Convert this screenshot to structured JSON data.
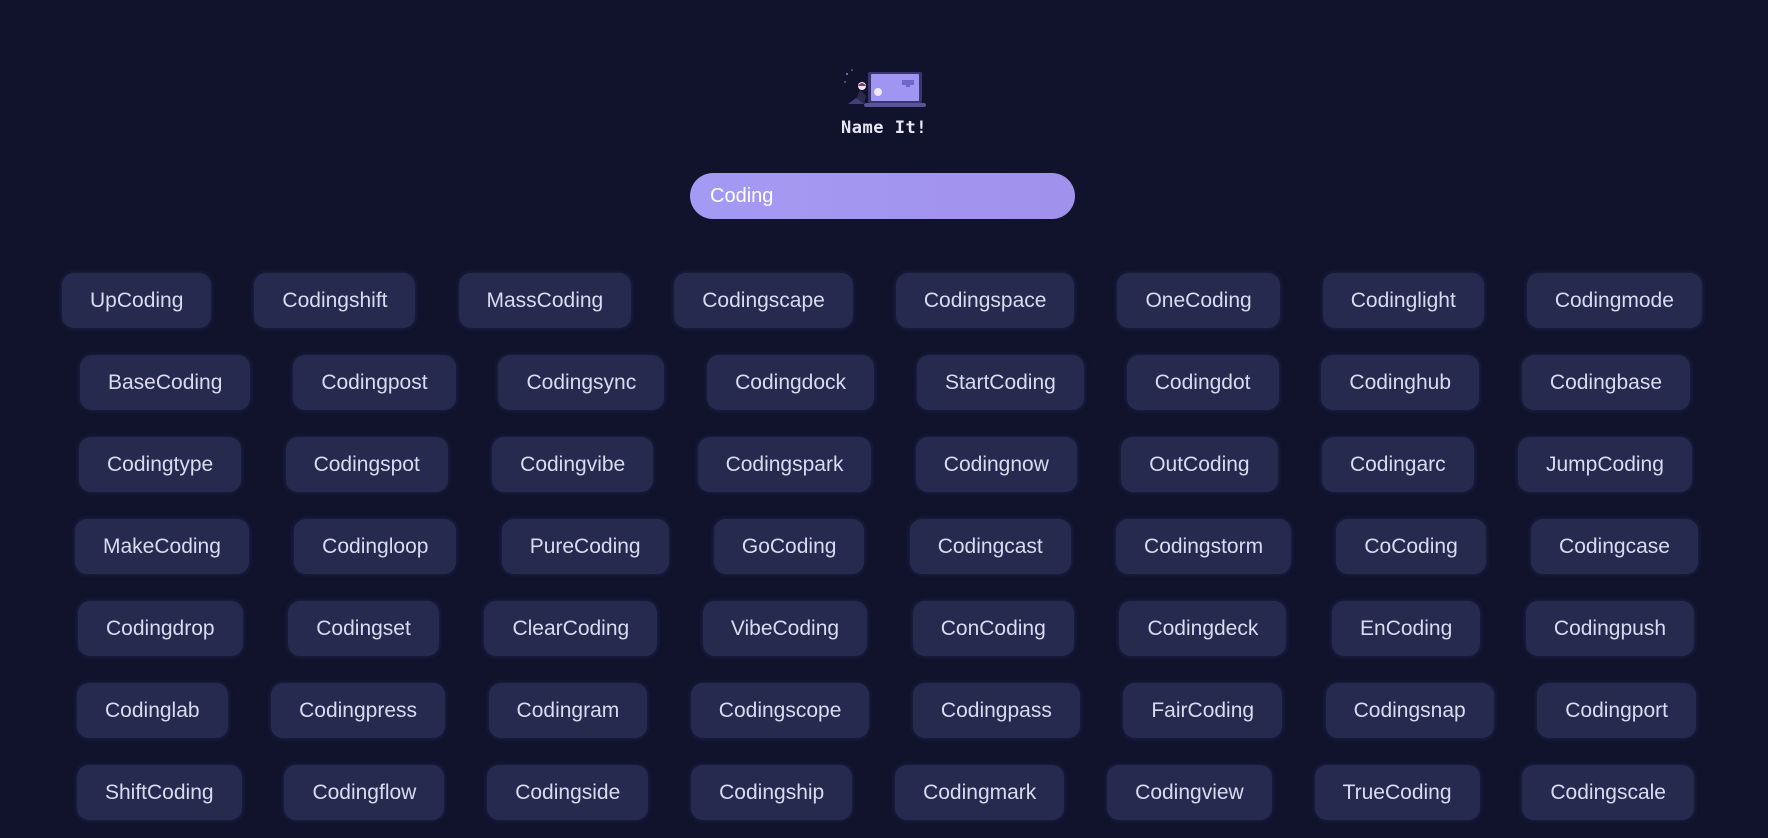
{
  "app": {
    "title": "Name It!",
    "logo_icon": "laptop-illustration-icon"
  },
  "search": {
    "value": "Coding",
    "placeholder": ""
  },
  "colors": {
    "background": "#10132b",
    "chip_background": "#262a4e",
    "chip_text": "#d9dbf0",
    "search_accent": "#a59af3"
  },
  "names": [
    [
      "UpCoding",
      "Codingshift",
      "MassCoding",
      "Codingscape",
      "Codingspace",
      "OneCoding",
      "Codinglight",
      "Codingmode"
    ],
    [
      "BaseCoding",
      "Codingpost",
      "Codingsync",
      "Codingdock",
      "StartCoding",
      "Codingdot",
      "Codinghub",
      "Codingbase"
    ],
    [
      "Codingtype",
      "Codingspot",
      "Codingvibe",
      "Codingspark",
      "Codingnow",
      "OutCoding",
      "Codingarc",
      "JumpCoding"
    ],
    [
      "MakeCoding",
      "Codingloop",
      "PureCoding",
      "GoCoding",
      "Codingcast",
      "Codingstorm",
      "CoCoding",
      "Codingcase"
    ],
    [
      "Codingdrop",
      "Codingset",
      "ClearCoding",
      "VibeCoding",
      "ConCoding",
      "Codingdeck",
      "EnCoding",
      "Codingpush"
    ],
    [
      "Codinglab",
      "Codingpress",
      "Codingram",
      "Codingscope",
      "Codingpass",
      "FairCoding",
      "Codingsnap",
      "Codingport"
    ],
    [
      "ShiftCoding",
      "Codingflow",
      "Codingside",
      "Codingship",
      "Codingmark",
      "Codingview",
      "TrueCoding",
      "Codingscale"
    ]
  ]
}
